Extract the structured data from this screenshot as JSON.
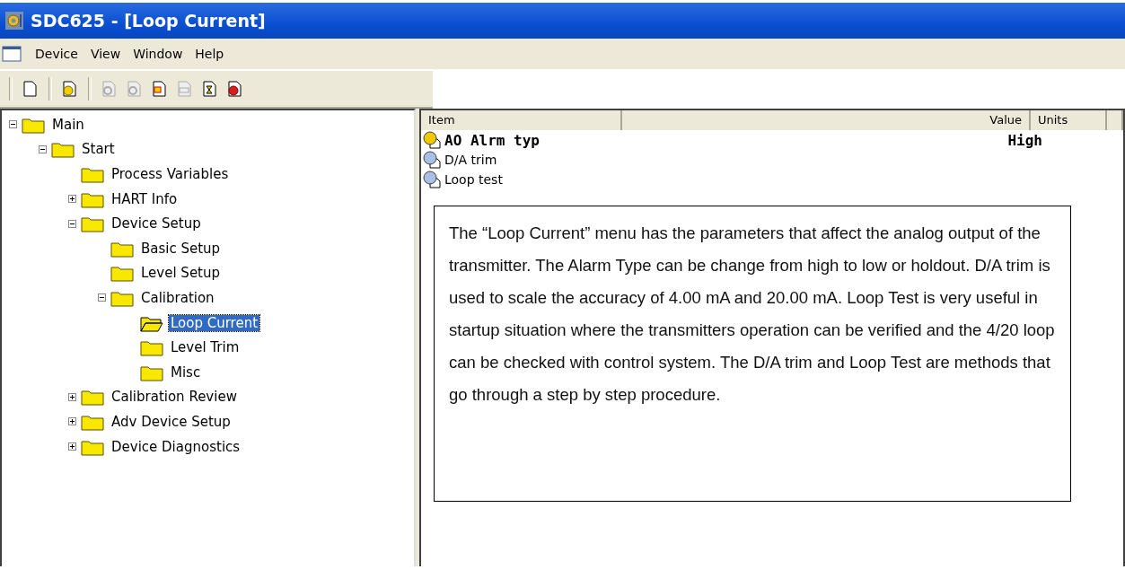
{
  "window": {
    "title": "SDC625 - [Loop Current]"
  },
  "menu": [
    "Device",
    "View",
    "Window",
    "Help"
  ],
  "toolbar": [
    {
      "disabled": false
    },
    {
      "disabled": false
    },
    {
      "disabled": true
    },
    {
      "disabled": true
    },
    {
      "disabled": false
    },
    {
      "disabled": true
    },
    {
      "disabled": false
    },
    {
      "disabled": false
    }
  ],
  "tree": [
    {
      "label": "Main",
      "expanded": true,
      "selected": false,
      "children": [
        {
          "label": "Start",
          "expanded": true,
          "selected": false,
          "children": [
            {
              "label": "Process Variables",
              "selected": false
            },
            {
              "label": "HART Info",
              "expanded": false,
              "selected": false
            },
            {
              "label": "Device Setup",
              "expanded": true,
              "selected": false,
              "children": [
                {
                  "label": "Basic Setup",
                  "selected": false
                },
                {
                  "label": "Level Setup",
                  "selected": false
                },
                {
                  "label": "Calibration",
                  "expanded": true,
                  "selected": false,
                  "children": [
                    {
                      "label": "Loop Current",
                      "selected": true
                    },
                    {
                      "label": "Level Trim",
                      "selected": false
                    },
                    {
                      "label": "Misc",
                      "selected": false
                    }
                  ]
                }
              ]
            },
            {
              "label": "Calibration Review",
              "expanded": false,
              "selected": false
            },
            {
              "label": "Adv Device Setup",
              "expanded": false,
              "selected": false
            },
            {
              "label": "Device Diagnostics",
              "expanded": false,
              "selected": false
            }
          ]
        }
      ]
    }
  ],
  "table": {
    "columns": [
      "Item",
      "Value",
      "Units"
    ],
    "rows": [
      {
        "kind": "variable",
        "item": "AO Alrm typ",
        "value": "High"
      },
      {
        "kind": "method",
        "item": "D/A trim"
      },
      {
        "kind": "method",
        "item": "Loop test"
      }
    ]
  },
  "note": "The “Loop Current” menu has the parameters that affect the analog output of the transmitter.  The Alarm Type can be change from high to low or holdout.  D/A trim is used to scale the accuracy of 4.00 mA and 20.00 mA.  Loop Test is very useful in startup situation where the transmitters operation can be verified and the 4/20 loop can be checked with control system.  The D/A trim and Loop Test are methods that go through a step by step procedure."
}
